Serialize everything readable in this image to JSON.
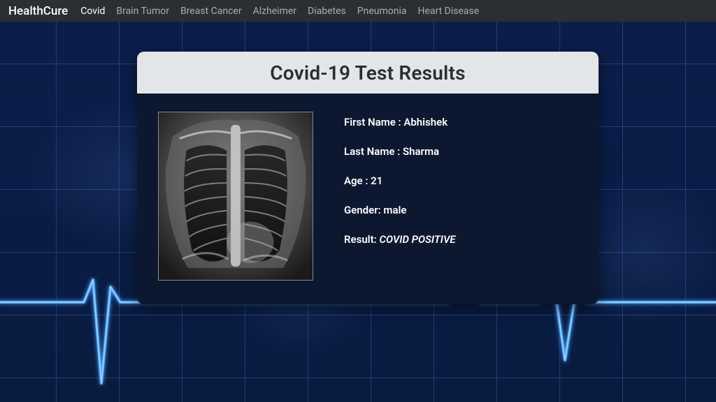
{
  "brand": "HealthCure",
  "nav": {
    "items": [
      "Covid",
      "Brain Tumor",
      "Breast Cancer",
      "Alzheimer",
      "Diabetes",
      "Pneumonia",
      "Heart Disease"
    ],
    "active_index": 0
  },
  "card": {
    "title": "Covid-19 Test Results",
    "image_alt": "chest-xray",
    "labels": {
      "first_name": "First Name :",
      "last_name": "Last Name :",
      "age": "Age :",
      "gender": "Gender:",
      "result": "Result:"
    },
    "values": {
      "first_name": "Abhishek",
      "last_name": "Sharma",
      "age": "21",
      "gender": "male",
      "result": "COVID POSITIVE"
    }
  },
  "colors": {
    "navbar_bg": "#2b2f33",
    "bg": "#0a1b40",
    "grid_line": "rgba(70,120,220,0.35)",
    "ecg_stroke": "#4aa8ff",
    "card_header_bg": "#e3e6e8",
    "card_body_bg": "#0c1830"
  }
}
